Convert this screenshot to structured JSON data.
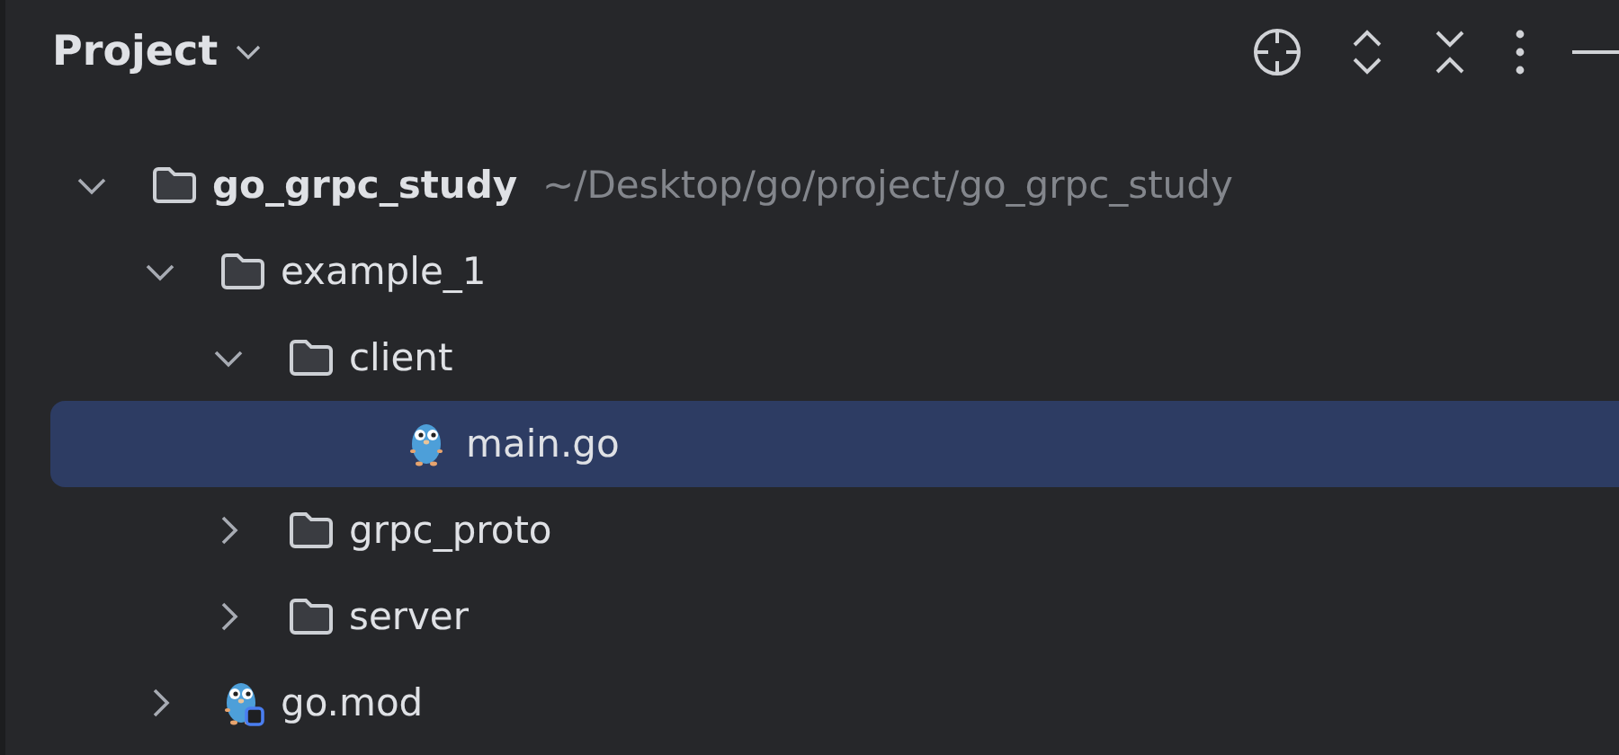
{
  "panel": {
    "title": "Project"
  },
  "tree": [
    {
      "kind": "folder",
      "label": "go_grpc_study",
      "path": "~/Desktop/go/project/go_grpc_study",
      "expanded": true,
      "selected": false,
      "children": [
        {
          "kind": "folder",
          "label": "example_1",
          "expanded": true,
          "selected": false,
          "children": [
            {
              "kind": "folder",
              "label": "client",
              "expanded": true,
              "selected": false,
              "children": [
                {
                  "kind": "go_file",
                  "label": "main.go",
                  "selected": true
                }
              ]
            },
            {
              "kind": "folder",
              "label": "grpc_proto",
              "expanded": false,
              "selected": false
            },
            {
              "kind": "folder",
              "label": "server",
              "expanded": false,
              "selected": false
            }
          ]
        },
        {
          "kind": "go_mod",
          "label": "go.mod",
          "expanded": false,
          "selected": false
        }
      ]
    }
  ]
}
